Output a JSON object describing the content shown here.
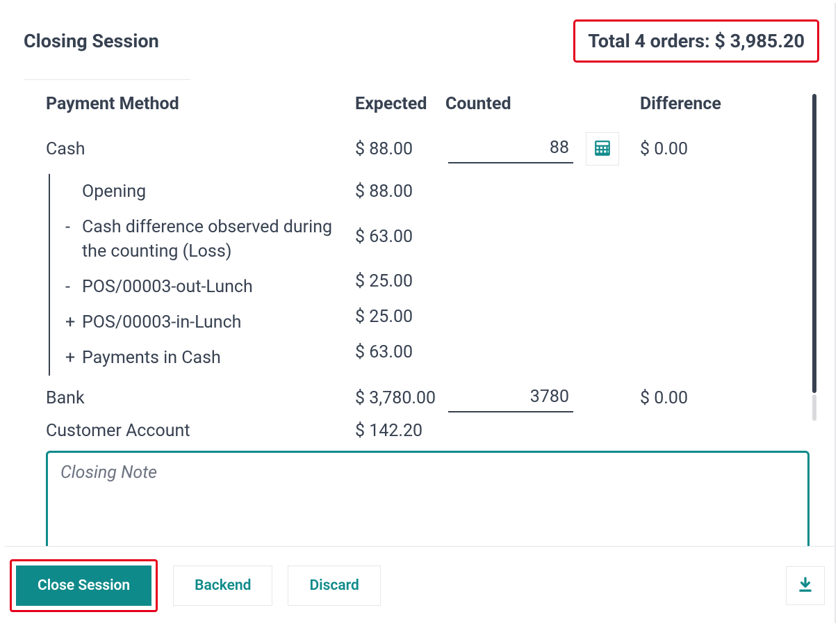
{
  "header": {
    "title": "Closing Session",
    "total_label": "Total 4 orders: $ 3,985.20"
  },
  "columns": {
    "method": "Payment Method",
    "expected": "Expected",
    "counted": "Counted",
    "difference": "Difference"
  },
  "rows": {
    "cash": {
      "label": "Cash",
      "expected": "$ 88.00",
      "counted": "88",
      "difference": "$ 0.00",
      "sub": [
        {
          "sign": "",
          "label": "Opening",
          "value": "$ 88.00"
        },
        {
          "sign": "-",
          "label": "Cash difference observed during the counting (Loss)",
          "value": "$ 63.00"
        },
        {
          "sign": "-",
          "label": "POS/00003-out-Lunch",
          "value": "$ 25.00"
        },
        {
          "sign": "+",
          "label": "POS/00003-in-Lunch",
          "value": "$ 25.00"
        },
        {
          "sign": "+",
          "label": "Payments in Cash",
          "value": "$ 63.00"
        }
      ]
    },
    "bank": {
      "label": "Bank",
      "expected": "$ 3,780.00",
      "counted": "3780",
      "difference": "$ 0.00"
    },
    "customer": {
      "label": "Customer Account",
      "expected": "$ 142.20"
    }
  },
  "note": {
    "placeholder": "Closing Note",
    "value": ""
  },
  "footer": {
    "close": "Close Session",
    "backend": "Backend",
    "discard": "Discard"
  }
}
